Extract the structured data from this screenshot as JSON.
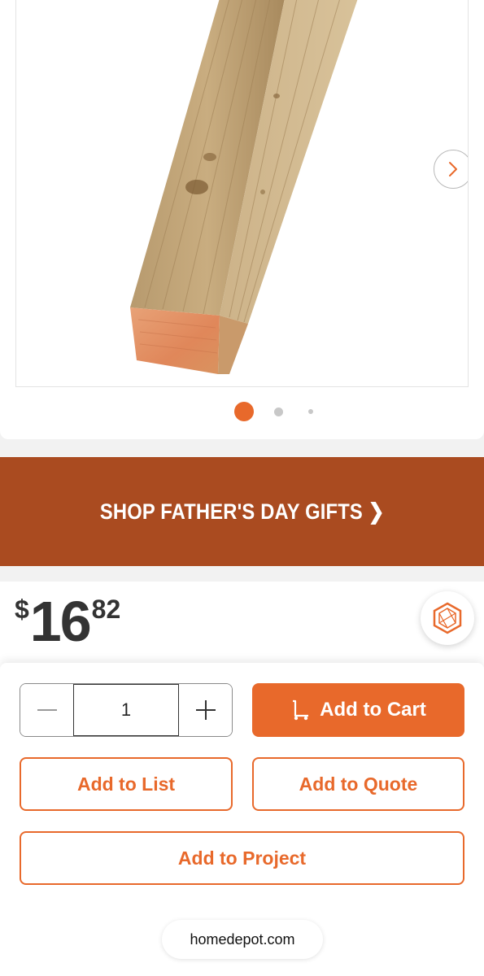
{
  "gallery": {
    "next_icon": "chevron-right-icon",
    "dots": 3,
    "active_dot": 1
  },
  "promo": {
    "text": "SHOP FATHER'S DAY GIFTS ❯"
  },
  "price": {
    "currency": "$",
    "dollars": "16",
    "cents": "82",
    "badge_icon": "hexagon-badge-icon"
  },
  "quantity": {
    "value": "1",
    "decrement_icon": "minus-icon",
    "increment_icon": "plus-icon"
  },
  "actions": {
    "add_to_cart": "Add to Cart",
    "add_to_list": "Add to List",
    "add_to_quote": "Add to Quote",
    "add_to_project": "Add to Project",
    "cart_icon": "dolly-icon"
  },
  "browser": {
    "url": "homedepot.com"
  },
  "colors": {
    "accent": "#e8692b",
    "banner": "#aa4b20",
    "text": "#333333"
  }
}
